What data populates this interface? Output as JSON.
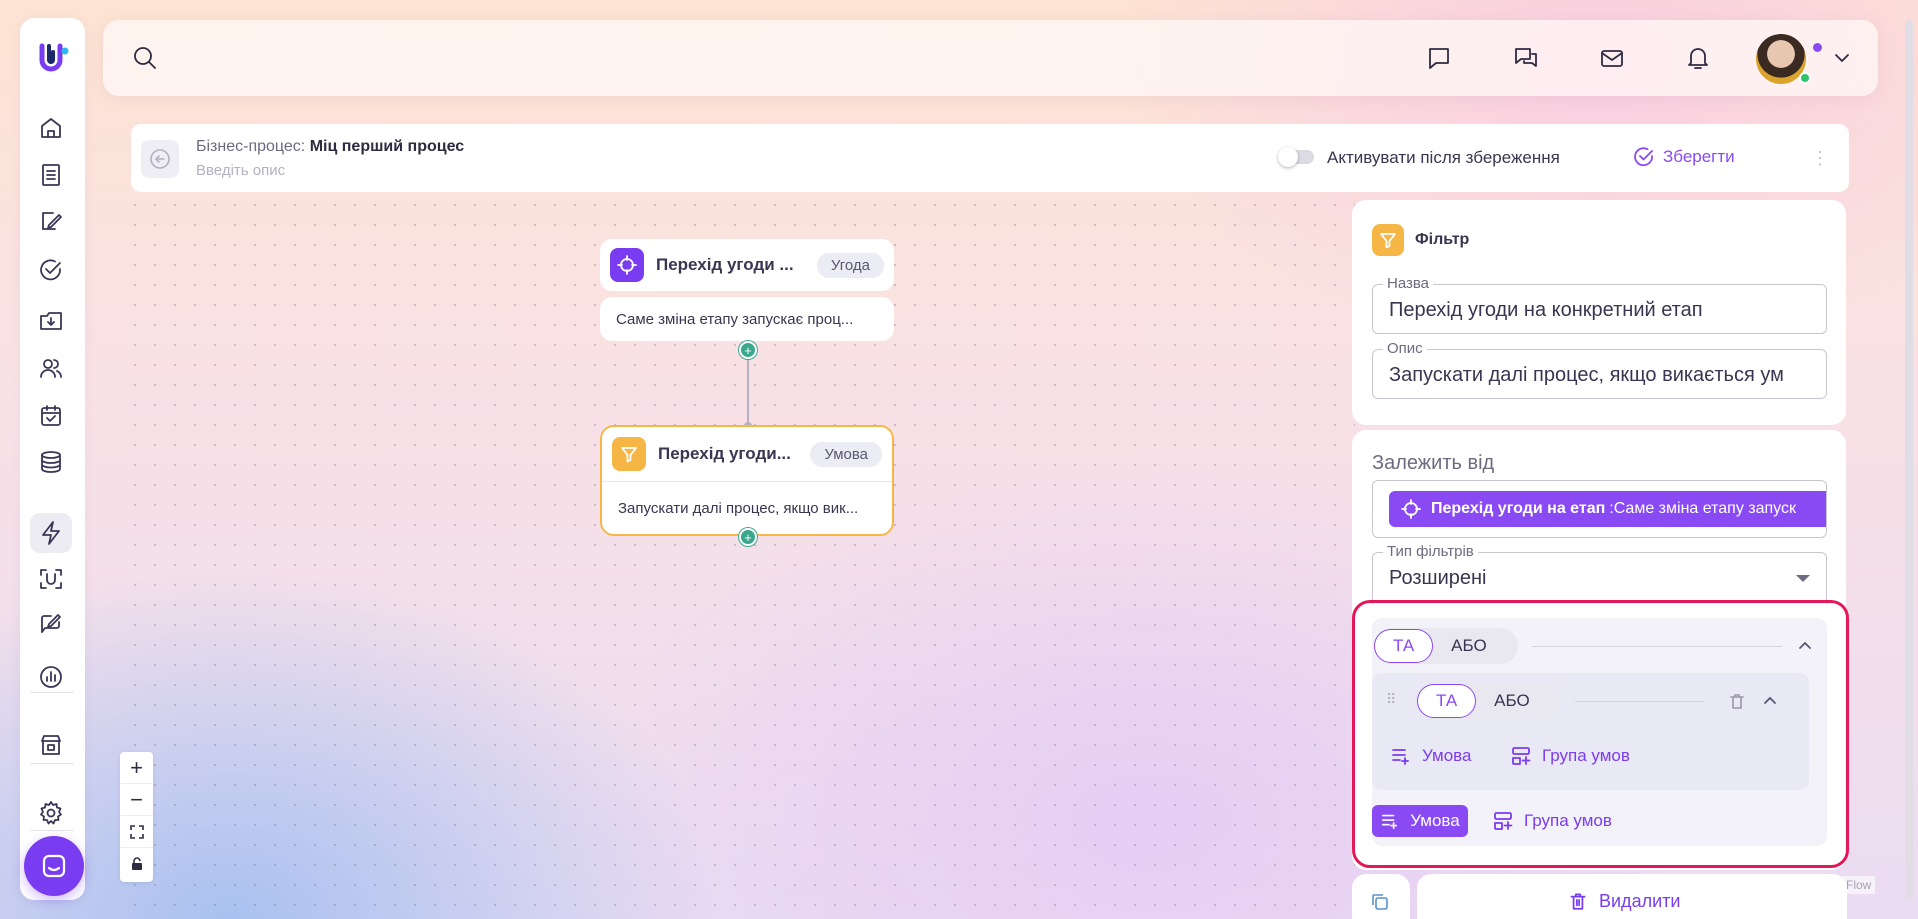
{
  "process": {
    "label": "Бізнес-процес:",
    "name": "Міц перший процес",
    "description_placeholder": "Введіть опис",
    "activate_label": "Активувати після збереження",
    "save_label": "Зберегти"
  },
  "nodes": [
    {
      "title": "Перехід угоди ...",
      "tag": "Угода",
      "body": "Саме зміна етапу запускає проц..."
    },
    {
      "title": "Перехід угоди...",
      "tag": "Умова",
      "body": "Запускати далі процес, якщо вик..."
    }
  ],
  "panel": {
    "title": "Фільтр",
    "name_label": "Назва",
    "name_value": "Перехід угоди на конкретний етап",
    "desc_label": "Опис",
    "desc_value": "Запускати далі процес, якщо викається ум",
    "depends_label": "Залежить від",
    "depends_chip_bold": "Перехід угоди на етап",
    "depends_chip_rest": ":Саме зміна етапу запуск",
    "filter_type_label": "Тип фільтрів",
    "filter_type_value": "Розширені",
    "and_label": "ТА",
    "or_label": "АБО",
    "condition_label": "Умова",
    "group_label": "Група умов",
    "delete_label": "Видалити"
  },
  "flow_tag": "Flow",
  "colors": {
    "accent": "#8a4af3",
    "highlight": "#e3175a",
    "filter_icon": "#f5b645",
    "connector_dot": "#3aa88c"
  }
}
